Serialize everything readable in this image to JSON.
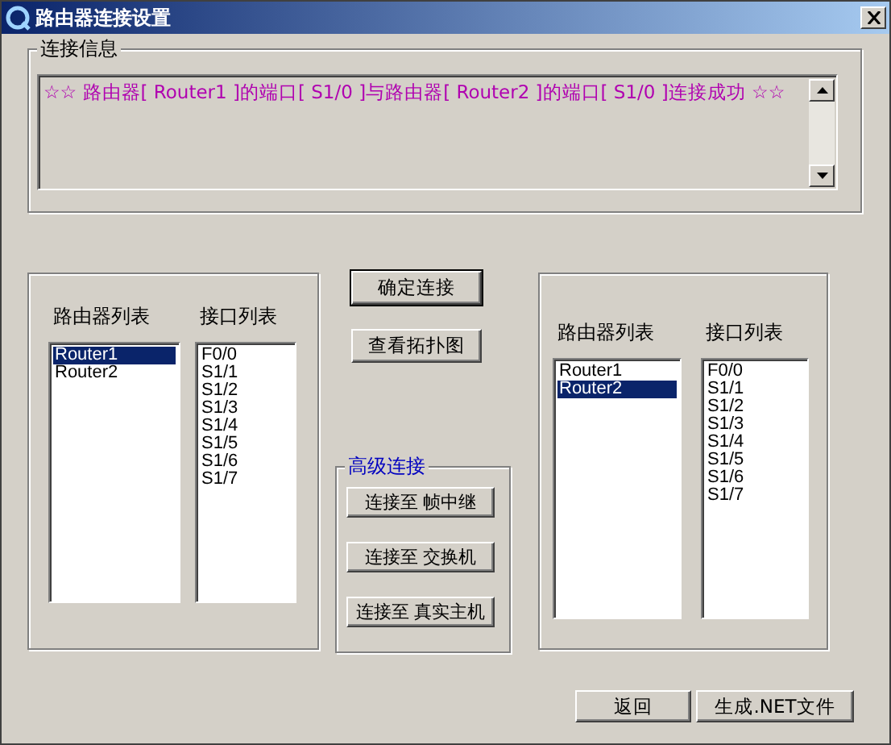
{
  "window": {
    "title": "路由器连接设置"
  },
  "info_group": {
    "label": "连接信息",
    "message": "☆☆ 路由器[ Router1 ]的端口[ S1/0 ]与路由器[ Router2 ]的端口[ S1/0 ]连接成功 ☆☆"
  },
  "panels": [
    {
      "router_label": "路由器列表",
      "interface_label": "接口列表",
      "routers": [
        {
          "name": "Router1",
          "selected": true
        },
        {
          "name": "Router2",
          "selected": false
        }
      ],
      "interfaces": [
        {
          "name": "F0/0",
          "selected": false
        },
        {
          "name": "S1/1",
          "selected": false
        },
        {
          "name": "S1/2",
          "selected": false
        },
        {
          "name": "S1/3",
          "selected": false
        },
        {
          "name": "S1/4",
          "selected": false
        },
        {
          "name": "S1/5",
          "selected": false
        },
        {
          "name": "S1/6",
          "selected": false
        },
        {
          "name": "S1/7",
          "selected": false
        }
      ]
    },
    {
      "router_label": "路由器列表",
      "interface_label": "接口列表",
      "routers": [
        {
          "name": "Router1",
          "selected": false
        },
        {
          "name": "Router2",
          "selected": true
        }
      ],
      "interfaces": [
        {
          "name": "F0/0",
          "selected": false
        },
        {
          "name": "S1/1",
          "selected": false
        },
        {
          "name": "S1/2",
          "selected": false
        },
        {
          "name": "S1/3",
          "selected": false
        },
        {
          "name": "S1/4",
          "selected": false
        },
        {
          "name": "S1/5",
          "selected": false
        },
        {
          "name": "S1/6",
          "selected": false
        },
        {
          "name": "S1/7",
          "selected": false
        }
      ]
    }
  ],
  "center_buttons": [
    {
      "label": "确定连接",
      "default": true
    },
    {
      "label": "查看拓扑图",
      "default": false
    }
  ],
  "advanced_group": {
    "label": "高级连接",
    "buttons": [
      "连接至 帧中继",
      "连接至 交换机",
      "连接至 真实主机"
    ]
  },
  "bottom_buttons": [
    "返回",
    "生成.NET文件"
  ]
}
